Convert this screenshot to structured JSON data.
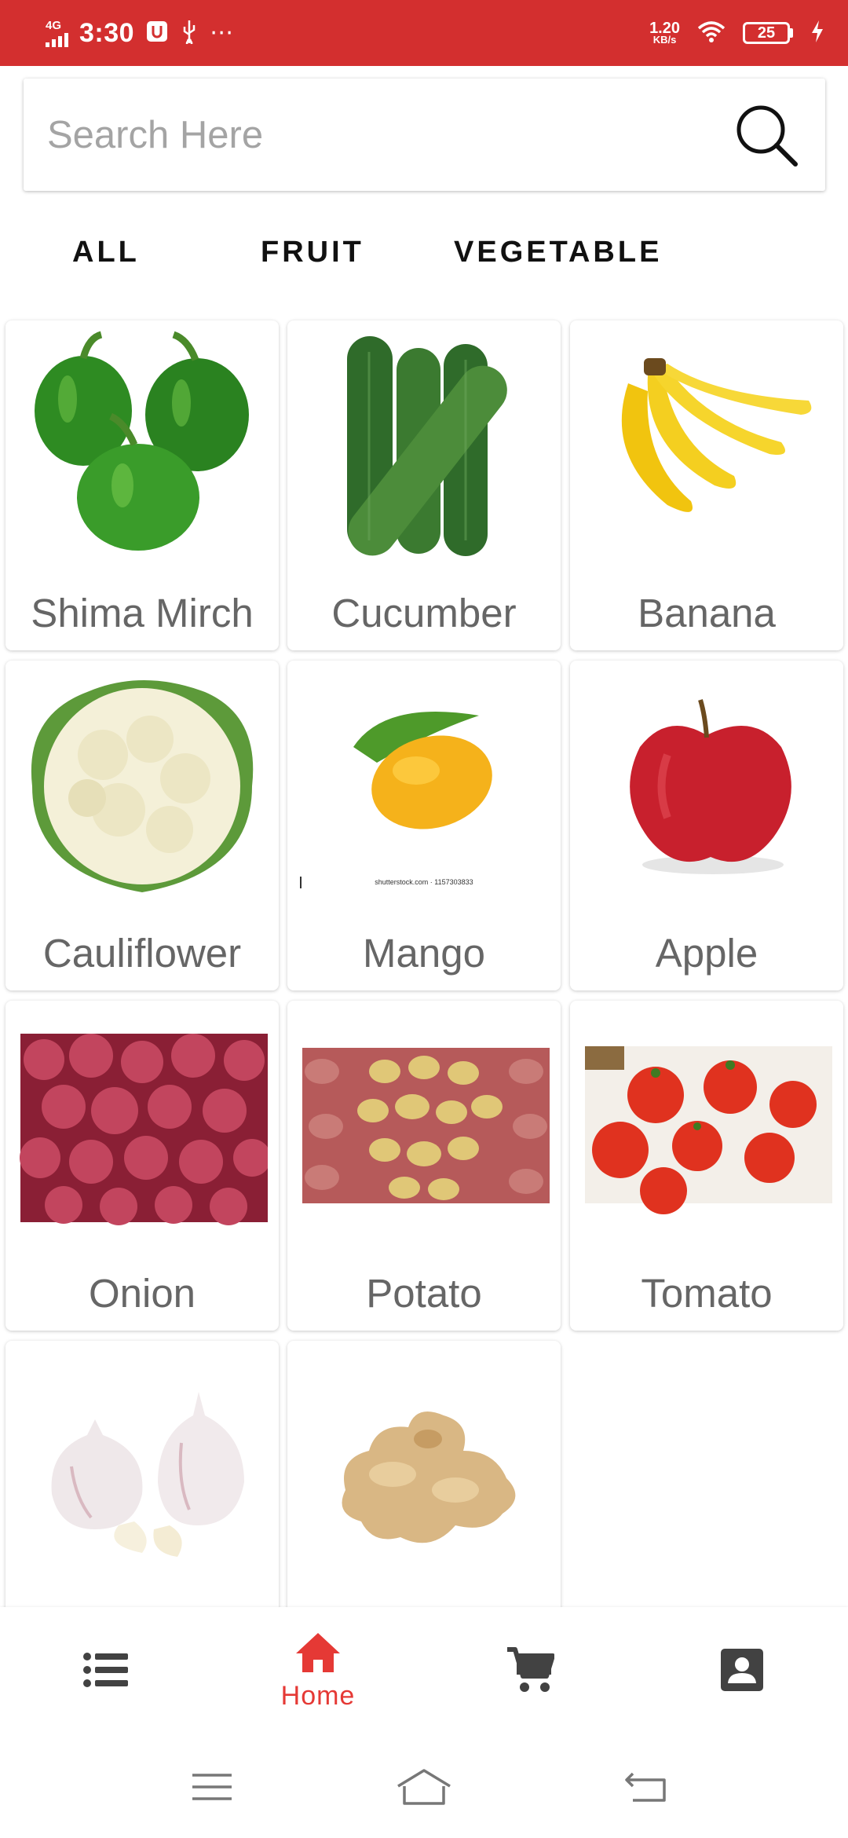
{
  "status_bar": {
    "network": "4G",
    "time": "3:30",
    "speed_value": "1.20",
    "speed_unit": "KB/s",
    "battery": "25",
    "icons": [
      "usb-debug-icon",
      "usb-icon",
      "more-dots-icon",
      "wifi-icon",
      "charging-icon"
    ],
    "color": "#D32F2F"
  },
  "search": {
    "placeholder": "Search Here"
  },
  "tabs": [
    {
      "label": "ALL"
    },
    {
      "label": "FRUIT"
    },
    {
      "label": "VEGETABLE"
    }
  ],
  "products": [
    {
      "name": "Shima Mirch",
      "image": "green-capsicum"
    },
    {
      "name": "Cucumber",
      "image": "cucumbers"
    },
    {
      "name": "Banana",
      "image": "bananas"
    },
    {
      "name": "Cauliflower",
      "image": "cauliflower"
    },
    {
      "name": "Mango",
      "image": "mango",
      "image_caption": "shutterstock.com · 1157303833"
    },
    {
      "name": "Apple",
      "image": "apple"
    },
    {
      "name": "Onion",
      "image": "onions"
    },
    {
      "name": "Potato",
      "image": "potatoes"
    },
    {
      "name": "Tomato",
      "image": "tomatoes"
    },
    {
      "name": "",
      "image": "garlic"
    },
    {
      "name": "",
      "image": "ginger"
    }
  ],
  "bottom_nav": {
    "items": [
      {
        "icon": "list-icon",
        "label": ""
      },
      {
        "icon": "home-icon",
        "label": "Home",
        "active": true
      },
      {
        "icon": "cart-icon",
        "label": ""
      },
      {
        "icon": "account-icon",
        "label": ""
      }
    ],
    "active_color": "#E53935",
    "inactive_color": "#424242"
  },
  "system_nav": [
    "menu-icon",
    "home-outline-icon",
    "back-icon"
  ]
}
